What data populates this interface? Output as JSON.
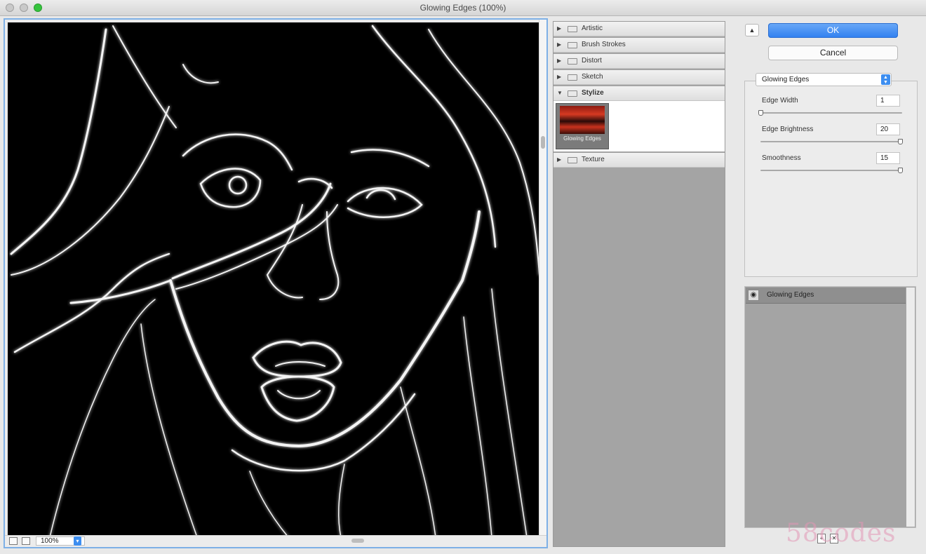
{
  "window": {
    "title": "Glowing Edges (100%)"
  },
  "preview": {
    "zoom": "100%"
  },
  "filter_gallery": {
    "categories": [
      {
        "label": "Artistic",
        "expanded": false
      },
      {
        "label": "Brush Strokes",
        "expanded": false
      },
      {
        "label": "Distort",
        "expanded": false
      },
      {
        "label": "Sketch",
        "expanded": false
      },
      {
        "label": "Stylize",
        "expanded": true
      },
      {
        "label": "Texture",
        "expanded": false
      }
    ],
    "stylize_thumbs": [
      {
        "label": "Glowing Edges",
        "selected": true
      }
    ]
  },
  "buttons": {
    "ok": "OK",
    "cancel": "Cancel"
  },
  "settings": {
    "filter_select": "Glowing Edges",
    "params": [
      {
        "label": "Edge Width",
        "value": "1",
        "level": 0.0
      },
      {
        "label": "Edge Brightness",
        "value": "20",
        "level": 1.0
      },
      {
        "label": "Smoothness",
        "value": "15",
        "level": 1.0
      }
    ]
  },
  "layers": [
    {
      "name": "Glowing Edges",
      "visible": true
    }
  ],
  "watermark": "58codes",
  "colors": {
    "accent": "#3d8ef0",
    "preview_bg": "#000000",
    "panel_gray": "#a4a4a4"
  }
}
